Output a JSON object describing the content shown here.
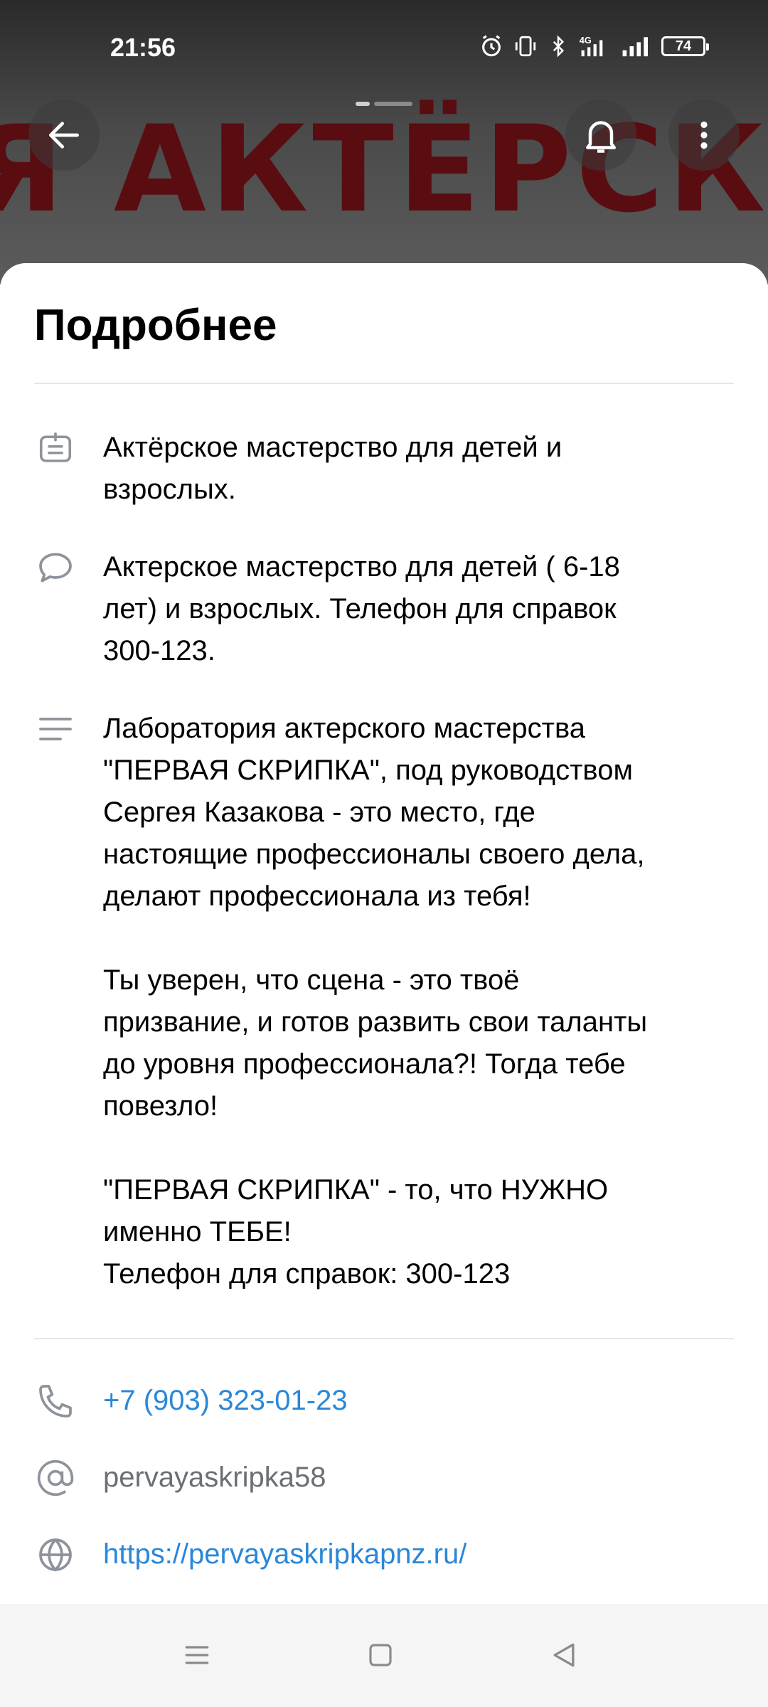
{
  "status_bar": {
    "time": "21:56",
    "battery": "74",
    "network": "4G"
  },
  "cover": {
    "background_text": "Я АКТЁРСКО"
  },
  "header_buttons": {
    "back": "arrow-left-icon",
    "notifications": "bell-icon",
    "more": "more-vertical-icon"
  },
  "sheet": {
    "title": "Подробнее",
    "items": [
      {
        "icon": "badge-icon",
        "text": "Актёрское мастерство для детей и\nвзрослых."
      },
      {
        "icon": "comment-icon",
        "text": "Актерское мастерство для детей ( 6-18\nлет) и взрослых. Телефон для справок\n300-123."
      },
      {
        "icon": "description-icon",
        "text": "Лаборатория актерского мастерства\n\"ПЕРВАЯ СКРИПКА\", под руководством\nСергея Казакова - это место, где\nнастоящие профессионалы своего дела,\nделают профессионала из тебя!\n\nТы уверен, что сцена - это твоё\nпризвание, и готов развить свои таланты\nдо уровня профессионала?! Тогда тебе\nповезло!\n\n\"ПЕРВАЯ СКРИПКА\" - то, что НУЖНО\nименно ТЕБЕ!\nТелефон для справок: 300-123"
      }
    ],
    "contacts": {
      "phone": "+7 (903) 323-01-23",
      "username": "pervayaskripka58",
      "website": "https://pervayaskripkapnz.ru/"
    }
  },
  "colors": {
    "link": "#2a87d9",
    "icon_gray": "#8e939b",
    "muted_text": "#6b6f76"
  }
}
